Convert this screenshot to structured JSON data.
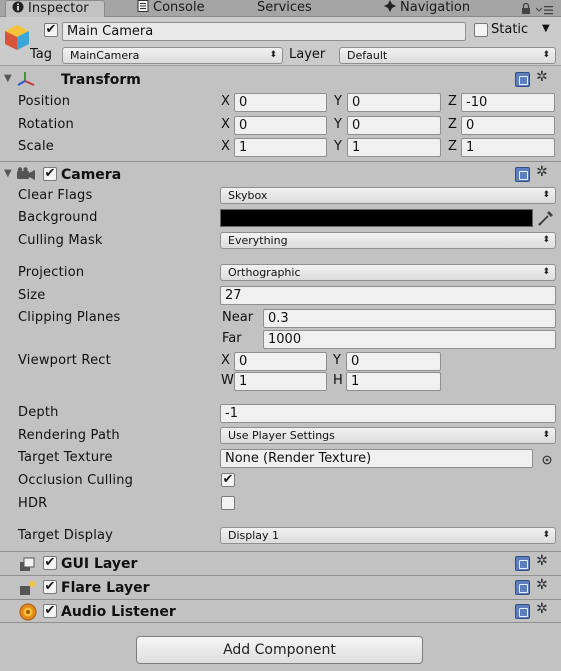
{
  "tabs": [
    {
      "label": "Inspector",
      "icon": "info-icon"
    },
    {
      "label": "Console",
      "icon": "console-icon"
    },
    {
      "label": "Services"
    },
    {
      "label": "Navigation",
      "icon": "navigation-icon"
    }
  ],
  "header": {
    "object_name": "Main Camera",
    "active_checked": true,
    "static_label": "Static",
    "tag_label": "Tag",
    "tag_value": "MainCamera",
    "layer_label": "Layer",
    "layer_value": "Default"
  },
  "transform": {
    "title": "Transform",
    "position": {
      "label": "Position",
      "x": "0",
      "y": "0",
      "z": "-10"
    },
    "rotation": {
      "label": "Rotation",
      "x": "0",
      "y": "0",
      "z": "0"
    },
    "scale": {
      "label": "Scale",
      "x": "1",
      "y": "1",
      "z": "1"
    },
    "x": "X",
    "y": "Y",
    "z": "Z"
  },
  "camera": {
    "title": "Camera",
    "clear_flags": {
      "label": "Clear Flags",
      "value": "Skybox"
    },
    "background": {
      "label": "Background",
      "color": "#000000"
    },
    "culling_mask": {
      "label": "Culling Mask",
      "value": "Everything"
    },
    "projection": {
      "label": "Projection",
      "value": "Orthographic"
    },
    "size": {
      "label": "Size",
      "value": "27"
    },
    "clipping": {
      "label": "Clipping Planes",
      "near_label": "Near",
      "near": "0.3",
      "far_label": "Far",
      "far": "1000"
    },
    "viewport": {
      "label": "Viewport Rect",
      "x_label": "X",
      "x": "0",
      "y_label": "Y",
      "y": "0",
      "w_label": "W",
      "w": "1",
      "h_label": "H",
      "h": "1"
    },
    "depth": {
      "label": "Depth",
      "value": "-1"
    },
    "rendering_path": {
      "label": "Rendering Path",
      "value": "Use Player Settings"
    },
    "target_texture": {
      "label": "Target Texture",
      "value": "None (Render Texture)"
    },
    "occlusion": {
      "label": "Occlusion Culling",
      "checked": true
    },
    "hdr": {
      "label": "HDR",
      "checked": false
    },
    "target_display": {
      "label": "Target Display",
      "value": "Display 1"
    }
  },
  "components": {
    "gui_layer": "GUI Layer",
    "flare_layer": "Flare Layer",
    "audio_listener": "Audio Listener"
  },
  "add_component": "Add Component"
}
